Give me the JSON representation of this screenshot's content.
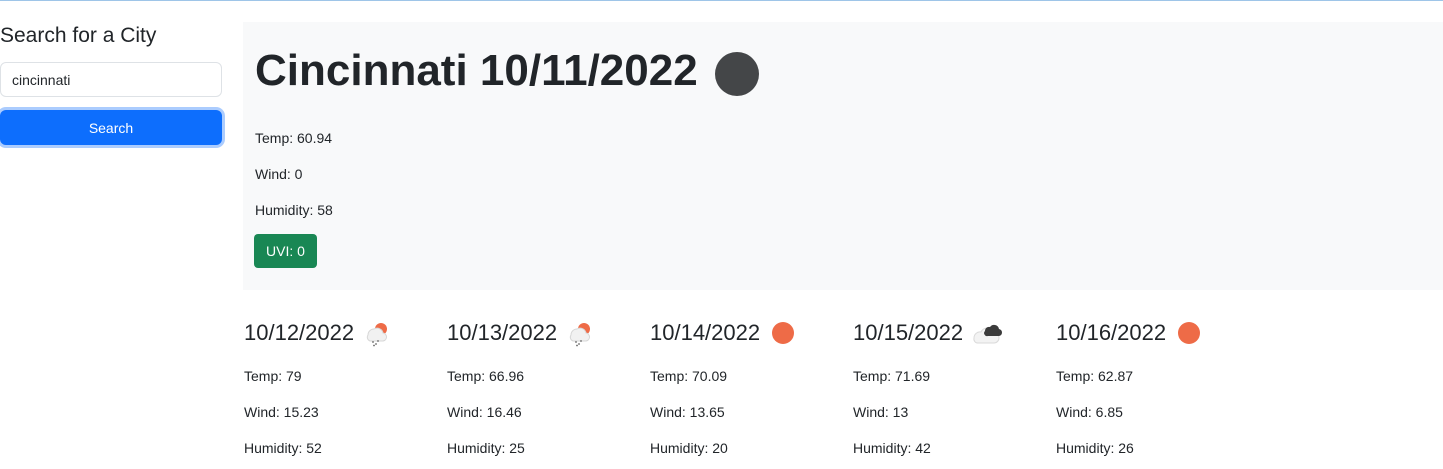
{
  "sidebar": {
    "heading": "Search for a City",
    "search_value": "cincinnati",
    "search_placeholder": "",
    "search_button_label": "Search"
  },
  "today": {
    "title": "Cincinnati 10/11/2022",
    "icon": "dark-circle-icon",
    "temp": "Temp: 60.94",
    "wind": "Wind: 0",
    "humidity": "Humidity: 58",
    "uvi": "UVI: 0",
    "uvi_color": "#198754"
  },
  "forecast": [
    {
      "date": "10/12/2022",
      "icon": "rain-sun-icon",
      "temp": "Temp: 79",
      "wind": "Wind: 15.23",
      "humidity": "Humidity: 52"
    },
    {
      "date": "10/13/2022",
      "icon": "rain-sun-icon",
      "temp": "Temp: 66.96",
      "wind": "Wind: 16.46",
      "humidity": "Humidity: 25"
    },
    {
      "date": "10/14/2022",
      "icon": "sun-icon",
      "temp": "Temp: 70.09",
      "wind": "Wind: 13.65",
      "humidity": "Humidity: 20"
    },
    {
      "date": "10/15/2022",
      "icon": "cloudy-icon",
      "temp": "Temp: 71.69",
      "wind": "Wind: 13",
      "humidity": "Humidity: 42"
    },
    {
      "date": "10/16/2022",
      "icon": "sun-icon",
      "temp": "Temp: 62.87",
      "wind": "Wind: 6.85",
      "humidity": "Humidity: 26"
    }
  ],
  "colors": {
    "accent": "#0d6efd",
    "sun": "#ee6b47",
    "panel_bg": "#f8f9fa"
  }
}
